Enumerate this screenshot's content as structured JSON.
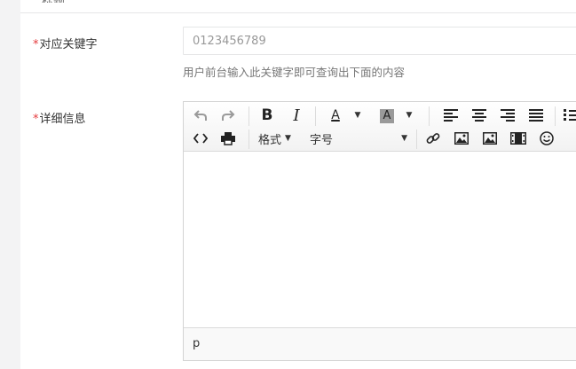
{
  "top_section": {
    "partial_label": "标题"
  },
  "keyword_field": {
    "required_mark": "*",
    "label": "对应关键字",
    "placeholder": "0123456789",
    "help": "用户前台输入此关键字即可查询出下面的内容"
  },
  "detail_field": {
    "required_mark": "*",
    "label": "详细信息"
  },
  "editor": {
    "toolbar_row1": [
      "undo-icon",
      "redo-icon",
      "bold-icon",
      "italic-icon",
      "font-color-icon",
      "highlight-color-icon",
      "align-left-icon",
      "align-center-icon",
      "align-right-icon",
      "align-justify-icon",
      "bullet-list-icon"
    ],
    "bold_glyph": "B",
    "italic_glyph": "I",
    "font_color_glyph": "A",
    "highlight_glyph": "A",
    "format_label": "格式",
    "size_label": "字号",
    "toolbar_row2": [
      "code-icon",
      "print-icon",
      "link-icon",
      "image-icon",
      "image-icon-2",
      "video-icon",
      "emoji-icon"
    ],
    "colors": {
      "highlight_bg": "#9a9a9a",
      "required": "#e4393c"
    },
    "status_path": "p"
  }
}
